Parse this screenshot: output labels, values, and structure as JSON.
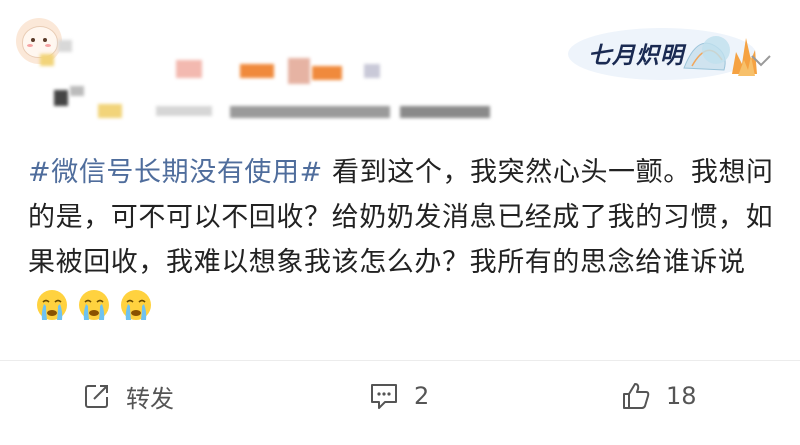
{
  "post": {
    "hashtag": "#微信号长期没有使用#",
    "text": " 看到这个，我突然心头一颤。我想问的是，可不可以不回收？给奶奶发消息已经成了我的习惯，如果被回收，我难以想象我该怎么办？我所有的思念给谁诉说",
    "emojis": [
      "crying-face-emoji",
      "crying-face-emoji",
      "crying-face-emoji"
    ]
  },
  "header": {
    "badge_text": "七月炽明",
    "avatar_icon": "cartoon-avatar-icon",
    "menu_icon": "chevron-down-icon"
  },
  "actions": {
    "repost_label": "转发",
    "comment_count": "2",
    "like_count": "18"
  },
  "colors": {
    "hashtag": "#4f6d9c",
    "text": "#222222",
    "icon": "#555555"
  }
}
